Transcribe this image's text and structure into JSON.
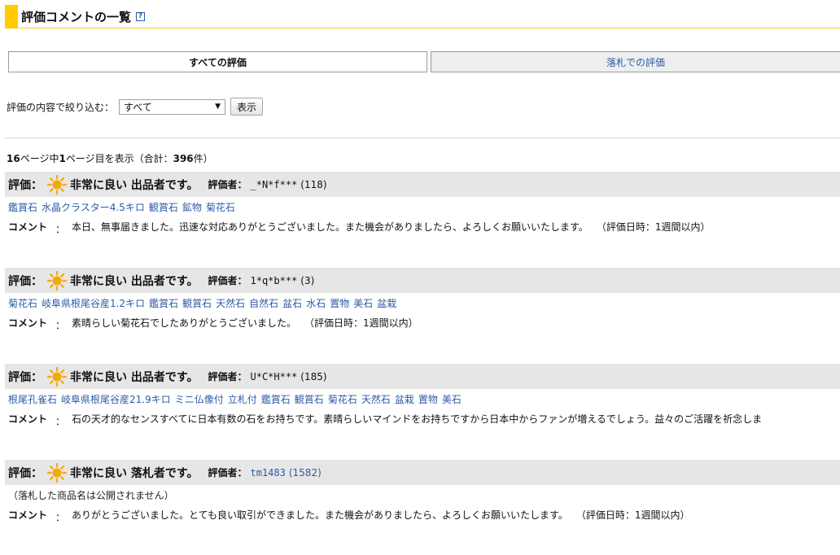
{
  "header": {
    "title": "評価コメントの一覧",
    "help_icon": "question-icon"
  },
  "tabs": [
    {
      "label": "すべての評価",
      "active": true
    },
    {
      "label": "落札での評価",
      "active": false
    }
  ],
  "filter": {
    "label": "評価の内容で絞り込む：",
    "selected": "すべて",
    "button": "表示"
  },
  "pager": {
    "total_pages": "16",
    "page_text1": "ページ中",
    "current_page": "1",
    "page_text2": "ページ目を表示（合計：",
    "total": "396",
    "page_text3": "件）"
  },
  "common": {
    "rating_label": "評価：",
    "evaluator_label": "評価者：",
    "comment_label": "コメント",
    "colon": "："
  },
  "entries": [
    {
      "rating": "非常に良い 出品者です。",
      "evaluator": "_*N*f***",
      "count": "(118)",
      "evaluator_link": false,
      "items": [
        "鑑賞石",
        "水晶クラスター4.5キロ",
        "観賞石",
        "鉱物",
        "菊花石"
      ],
      "private_note": "",
      "comment": "本日、無事届きました。迅速な対応ありがとうございました。また機会がありましたら、よろしくお願いいたします。",
      "date": "（評価日時：1週間以内）"
    },
    {
      "rating": "非常に良い 出品者です。",
      "evaluator": "1*q*b***",
      "count": "(3)",
      "evaluator_link": false,
      "items": [
        "菊花石",
        "岐阜県根尾谷産1.2キロ",
        "鑑賞石",
        "観賞石",
        "天然石",
        "自然石",
        "盆石",
        "水石",
        "置物",
        "美石",
        "盆栽"
      ],
      "private_note": "",
      "comment": "素晴らしい菊花石でしたありがとうございました。",
      "date": "（評価日時：1週間以内）"
    },
    {
      "rating": "非常に良い 出品者です。",
      "evaluator": "U*C*H***",
      "count": "(185)",
      "evaluator_link": false,
      "items": [
        "根尾孔雀石",
        "岐阜県根尾谷産21.9キロ",
        "ミニ仏像付",
        "立札付",
        "鑑賞石",
        "観賞石",
        "菊花石",
        "天然石",
        "盆栽",
        "置物",
        "美石"
      ],
      "private_note": "",
      "comment": "石の天才的なセンスすべてに日本有数の石をお持ちです。素晴らしいマインドをお持ちですから日本中からファンが増えるでしょう。益々のご活躍を祈念しま",
      "date": ""
    },
    {
      "rating": "非常に良い 落札者です。",
      "evaluator": "tm1483",
      "count": "(1582)",
      "evaluator_link": true,
      "items": [],
      "private_note": "（落札した商品名は公開されません）",
      "comment": "ありがとうございました。とても良い取引ができました。また機会がありましたら、よろしくお願いいたします。",
      "date": "（評価日時：1週間以内）"
    }
  ],
  "colors": {
    "accent": "#ffcc00",
    "link": "#2d5ba8",
    "bar": "#e6e6e6",
    "sun": "#f5a800"
  }
}
